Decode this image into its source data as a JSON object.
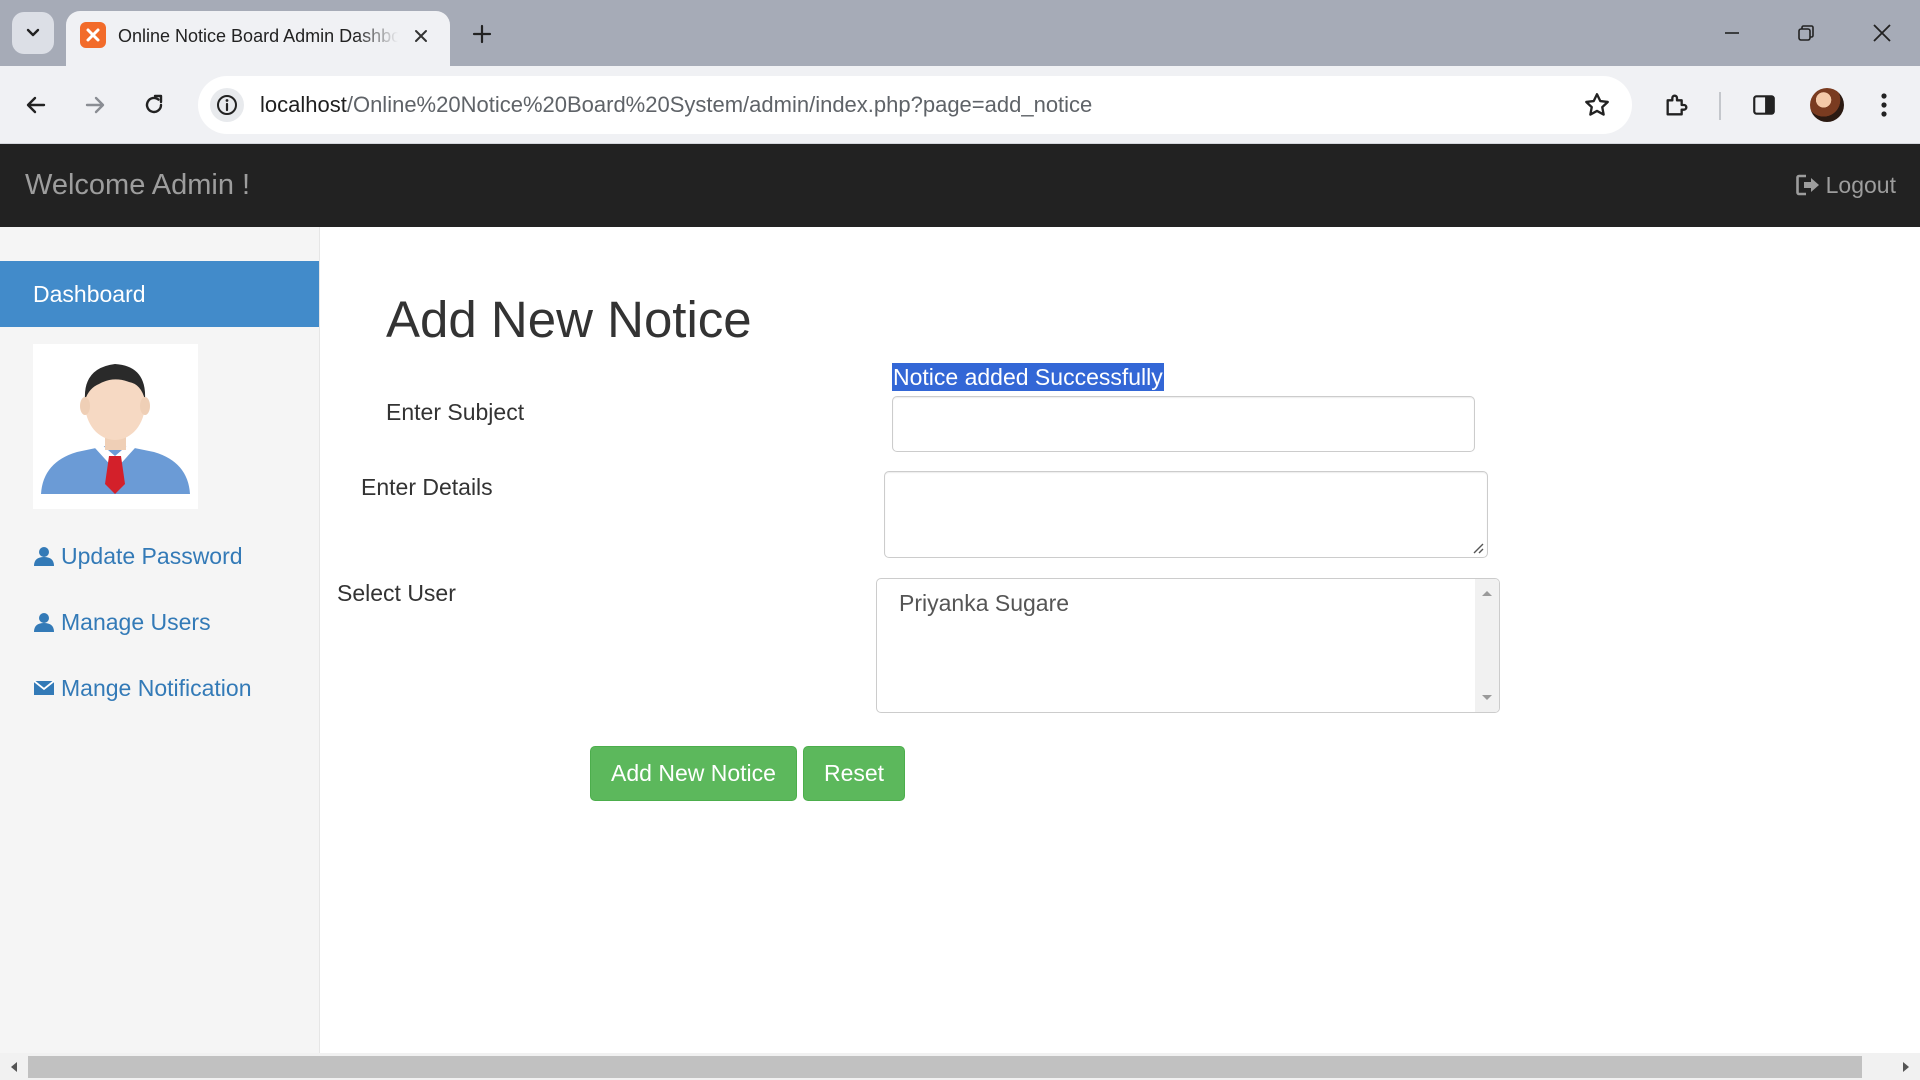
{
  "browser": {
    "tab_title": "Online Notice Board Admin Dashboard",
    "url_host": "localhost",
    "url_path": "/Online%20Notice%20Board%20System/admin/index.php?page=add_notice",
    "icons": [
      "tab-list-icon",
      "xampp-favicon-icon",
      "close-icon",
      "plus-icon",
      "minimize-icon",
      "restore-icon",
      "window-close-icon",
      "back-icon",
      "forward-icon",
      "reload-icon",
      "info-icon",
      "star-icon",
      "extensions-icon",
      "side-panel-icon",
      "profile-avatar-icon",
      "more-menu-icon"
    ]
  },
  "navbar": {
    "brand": "Welcome Admin !",
    "logout_label": "Logout"
  },
  "sidebar": {
    "active_item": "Dashboard",
    "links": [
      {
        "label": "Update Password",
        "icon": "user-icon"
      },
      {
        "label": "Manage Users",
        "icon": "user-icon"
      },
      {
        "label": "Mange Notification",
        "icon": "envelope-icon"
      }
    ]
  },
  "main": {
    "title": "Add New Notice",
    "success_message": "Notice added Successfully",
    "subject_label": "Enter Subject",
    "subject_value": "",
    "details_label": "Enter Details",
    "details_value": "",
    "user_label": "Select User",
    "user_options": [
      "Priyanka Sugare"
    ],
    "submit_label": "Add New Notice",
    "reset_label": "Reset"
  },
  "colors": {
    "navbar_bg": "#222222",
    "sidebar_active": "#428bca",
    "link": "#337ab7",
    "button_success": "#5cb85c",
    "selection": "#3367d6"
  }
}
